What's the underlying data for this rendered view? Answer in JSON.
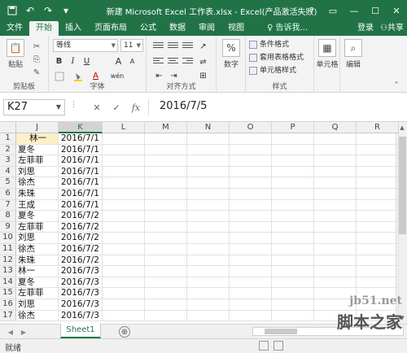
{
  "app": {
    "title": "新建 Microsoft Excel 工作表.xlsx - Excel(产品激活失败)",
    "window_buttons": [
      "?",
      "▭",
      "—",
      "☐",
      "✕"
    ],
    "accent_color": "#217346"
  },
  "quick_access": [
    "save-icon",
    "undo-icon",
    "redo-icon",
    "customize-icon"
  ],
  "ribbon_tabs": [
    {
      "label": "文件",
      "active": false
    },
    {
      "label": "开始",
      "active": true
    },
    {
      "label": "插入",
      "active": false
    },
    {
      "label": "页面布局",
      "active": false
    },
    {
      "label": "公式",
      "active": false
    },
    {
      "label": "数据",
      "active": false
    },
    {
      "label": "审阅",
      "active": false
    },
    {
      "label": "视图",
      "active": false
    }
  ],
  "tell_me": "♀ 告诉我...",
  "account": {
    "login": "登录",
    "share": "共享"
  },
  "ribbon": {
    "clipboard": {
      "paste": "粘贴",
      "label": "剪贴板"
    },
    "font": {
      "name": "等线",
      "size": "11",
      "bold": "B",
      "italic": "I",
      "underline": "U",
      "grow": "A",
      "shrink": "A",
      "color": "A",
      "wen": "wén",
      "label": "字体"
    },
    "alignment": {
      "label": "对齐方式"
    },
    "number": {
      "percent": "%",
      "label": "数字"
    },
    "styles": {
      "conditional": "条件格式",
      "table": "套用表格格式",
      "cell": "单元格样式",
      "label": "样式"
    },
    "cells": {
      "label": "单元格"
    },
    "editing": {
      "label": "编辑"
    }
  },
  "formula_bar": {
    "name_box": "K27",
    "cancel": "✕",
    "enter": "✓",
    "fx": "fx",
    "value": "2016/7/5"
  },
  "grid": {
    "columns": [
      "J",
      "K",
      "L",
      "M",
      "N",
      "O",
      "P",
      "Q",
      "R"
    ],
    "selected_column": "K",
    "rows": [
      {
        "num": "1",
        "j": "林一",
        "k": "2016/7/1"
      },
      {
        "num": "2",
        "j": "夏冬",
        "k": "2016/7/1"
      },
      {
        "num": "3",
        "j": "左菲菲",
        "k": "2016/7/1"
      },
      {
        "num": "4",
        "j": "刘思",
        "k": "2016/7/1"
      },
      {
        "num": "5",
        "j": "徐杰",
        "k": "2016/7/1"
      },
      {
        "num": "6",
        "j": "朱珠",
        "k": "2016/7/1"
      },
      {
        "num": "7",
        "j": "王成",
        "k": "2016/7/1"
      },
      {
        "num": "8",
        "j": "夏冬",
        "k": "2016/7/2"
      },
      {
        "num": "9",
        "j": "左菲菲",
        "k": "2016/7/2"
      },
      {
        "num": "10",
        "j": "刘思",
        "k": "2016/7/2"
      },
      {
        "num": "11",
        "j": "徐杰",
        "k": "2016/7/2"
      },
      {
        "num": "12",
        "j": "朱珠",
        "k": "2016/7/2"
      },
      {
        "num": "13",
        "j": "林一",
        "k": "2016/7/3"
      },
      {
        "num": "14",
        "j": "夏冬",
        "k": "2016/7/3"
      },
      {
        "num": "15",
        "j": "左菲菲",
        "k": "2016/7/3"
      },
      {
        "num": "16",
        "j": "刘思",
        "k": "2016/7/3"
      },
      {
        "num": "17",
        "j": "徐杰",
        "k": "2016/7/3"
      }
    ]
  },
  "sheets": [
    {
      "name": "Sheet1",
      "active": true
    }
  ],
  "add_sheet": "⊕",
  "status": {
    "text": "就绪"
  },
  "watermark": {
    "line1": "jb51.net",
    "line2": "脚本之家"
  }
}
